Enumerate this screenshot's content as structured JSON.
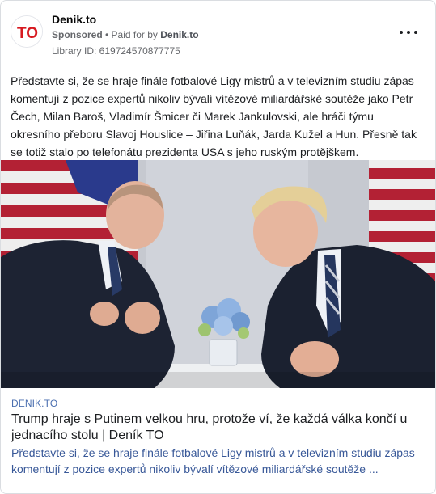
{
  "post": {
    "page_name": "Denik.to",
    "sponsored_label": "Sponsored",
    "paid_for_prefix": " • Paid for by ",
    "paid_for_by": "Denik.to",
    "library_id": "Library ID: 619724570877775",
    "more_icon": "more-horizontal-icon",
    "avatar_logo_text": "TO",
    "brand_color": "#d71920",
    "body_text": "Představte si, že se hraje finále fotbalové Ligy mistrů a v televizním studiu zápas komentují z pozice expertů nikoliv bývalí vítězové miliardářské soutěže jako Petr Čech, Milan Baroš, Vladimír Šmicer či Marek Jankulovski, ale hráči týmu okresního přeboru Slavoj Houslice – Jiřina Luňák, Jarda Kužel a Hun. Přesně tak se totiž stalo po telefonátu prezidenta USA s jeho ruským protějškem."
  },
  "link": {
    "domain": "DENIK.TO",
    "title": "Trump hraje s Putinem velkou hru, protože ví, že každá válka končí u jednacího stolu | Deník TO",
    "description": "Představte si, že se hraje finále fotbalové Ligy mistrů a v televizním studiu zápas komentují z pozice expertů nikoliv bývalí vítězové miliardářské soutěže ...",
    "link_color": "#385898"
  }
}
